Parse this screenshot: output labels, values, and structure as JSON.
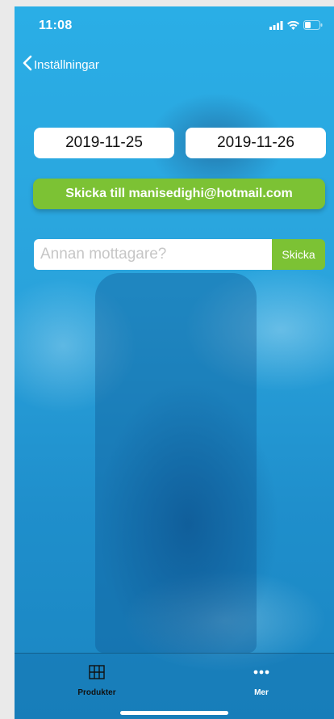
{
  "status_bar": {
    "time": "11:08",
    "signal_icon": "signal-icon",
    "wifi_icon": "wifi-icon",
    "battery_icon": "battery-icon"
  },
  "nav": {
    "back_label": "Inställningar",
    "back_icon": "chevron-left-icon"
  },
  "dates": {
    "from": "2019-11-25",
    "to": "2019-11-26"
  },
  "send_default": {
    "label": "Skicka till manisedighi@hotmail.com"
  },
  "recipient": {
    "value": "",
    "placeholder": "Annan mottagare?",
    "send_label": "Skicka"
  },
  "tabs": [
    {
      "label": "Produkter",
      "icon": "grid-icon"
    },
    {
      "label": "Mer",
      "icon": "more-dots-icon"
    }
  ],
  "colors": {
    "accent_green": "#7cc234",
    "background_blue": "#2aa3dc",
    "white": "#ffffff"
  }
}
